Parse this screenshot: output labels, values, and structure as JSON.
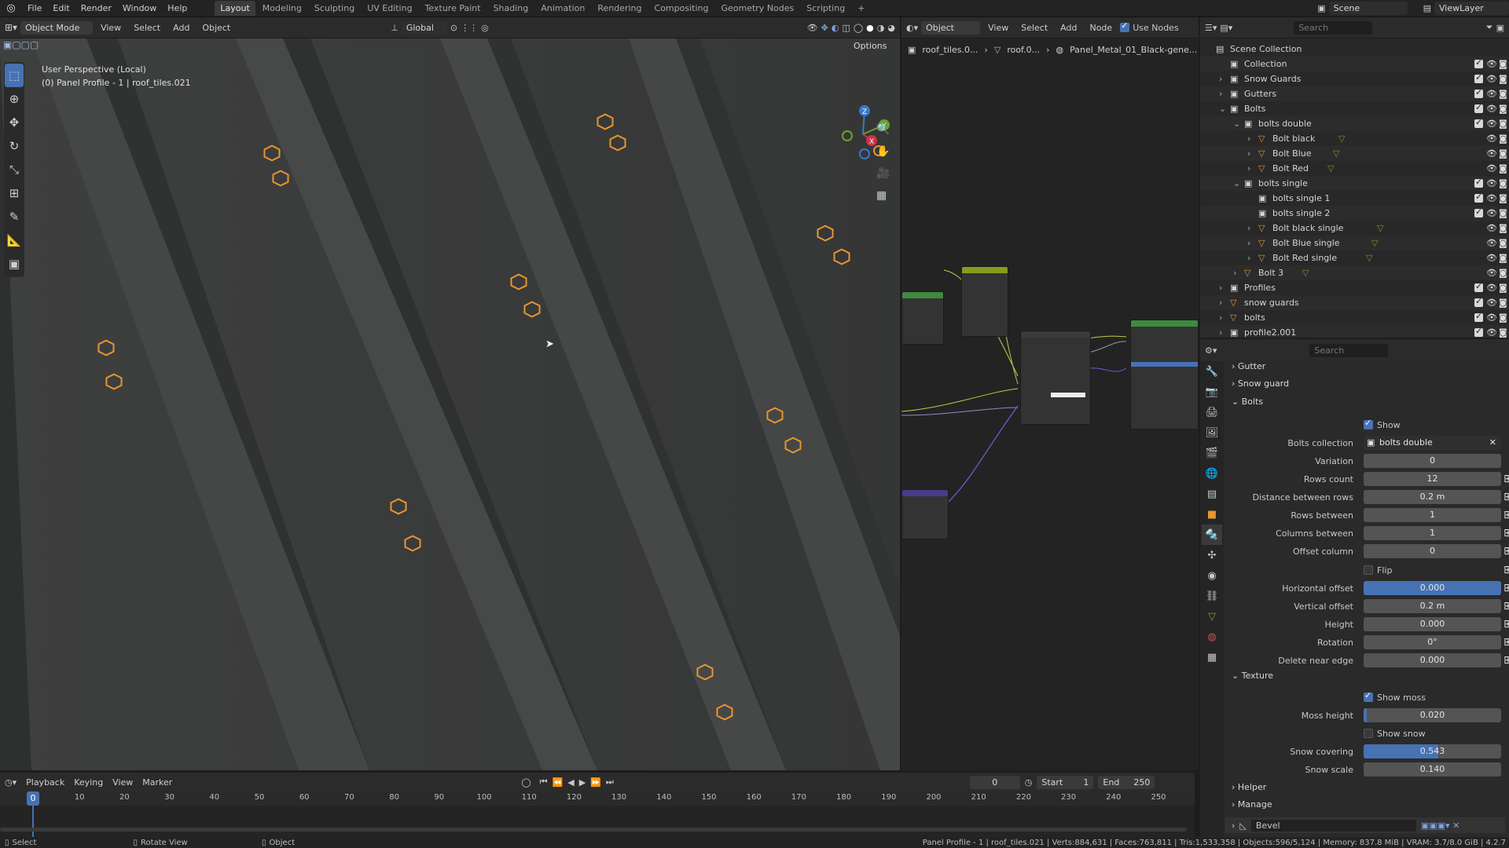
{
  "menus": [
    "File",
    "Edit",
    "Render",
    "Window",
    "Help"
  ],
  "workspaces": [
    "Layout",
    "Modeling",
    "Sculpting",
    "UV Editing",
    "Texture Paint",
    "Shading",
    "Animation",
    "Rendering",
    "Compositing",
    "Geometry Nodes",
    "Scripting"
  ],
  "active_workspace": "Layout",
  "top_right": {
    "scene": "Scene",
    "view_layer": "ViewLayer",
    "search_placeholder": "Search"
  },
  "viewport": {
    "mode": "Object Mode",
    "menu": [
      "View",
      "Select",
      "Add",
      "Object"
    ],
    "orientation": "Global",
    "options": "Options",
    "overlay_line1": "User Perspective (Local)",
    "overlay_line2": "(0) Panel Profile - 1 | roof_tiles.021",
    "gizmo_axes": [
      "Z",
      "Y",
      "X"
    ]
  },
  "node_editor": {
    "object_dropdown": "Object",
    "menu": [
      "View",
      "Select",
      "Add",
      "Node"
    ],
    "use_nodes_label": "Use Nodes",
    "use_nodes": true,
    "breadcrumb": [
      "roof_tiles.0...",
      "roof.0...",
      "Panel_Metal_01_Black-gene..."
    ]
  },
  "outliner": {
    "rows": [
      {
        "label": "Scene Collection",
        "depth": 0,
        "type": "scene",
        "checks": false
      },
      {
        "label": "Collection",
        "depth": 1,
        "type": "collection",
        "checks": true
      },
      {
        "label": "Snow Guards",
        "depth": 1,
        "type": "collection",
        "checks": true,
        "expand": "›"
      },
      {
        "label": "Gutters",
        "depth": 1,
        "type": "collection",
        "checks": true,
        "expand": "›"
      },
      {
        "label": "Bolts",
        "depth": 1,
        "type": "collection",
        "checks": true,
        "expand": "⌄"
      },
      {
        "label": "bolts double",
        "depth": 2,
        "type": "collection",
        "checks": true,
        "expand": "⌄"
      },
      {
        "label": "Bolt black",
        "depth": 3,
        "type": "mesh",
        "checks": false,
        "expand": "›"
      },
      {
        "label": "Bolt Blue",
        "depth": 3,
        "type": "mesh",
        "checks": false,
        "expand": "›"
      },
      {
        "label": "Bolt Red",
        "depth": 3,
        "type": "mesh",
        "checks": false,
        "expand": "›"
      },
      {
        "label": "bolts single",
        "depth": 2,
        "type": "collection",
        "checks": true,
        "expand": "⌄"
      },
      {
        "label": "bolts single 1",
        "depth": 3,
        "type": "collection",
        "checks": true
      },
      {
        "label": "bolts single 2",
        "depth": 3,
        "type": "collection",
        "checks": true
      },
      {
        "label": "Bolt black single",
        "depth": 3,
        "type": "mesh",
        "checks": false,
        "expand": "›"
      },
      {
        "label": "Bolt Blue single",
        "depth": 3,
        "type": "mesh",
        "checks": false,
        "expand": "›"
      },
      {
        "label": "Bolt Red single",
        "depth": 3,
        "type": "mesh",
        "checks": false,
        "expand": "›"
      },
      {
        "label": "Bolt 3",
        "depth": 2,
        "type": "mesh",
        "checks": false,
        "expand": "›"
      },
      {
        "label": "Profiles",
        "depth": 1,
        "type": "collection",
        "checks": true,
        "expand": "›"
      },
      {
        "label": "snow guards",
        "depth": 1,
        "type": "mesh",
        "checks": true,
        "expand": "›"
      },
      {
        "label": "bolts",
        "depth": 1,
        "type": "mesh",
        "checks": true,
        "expand": "›"
      },
      {
        "label": "profile2.001",
        "depth": 1,
        "type": "collection",
        "checks": true,
        "expand": "›"
      }
    ]
  },
  "properties": {
    "search_placeholder": "Search",
    "sections": {
      "gutter": "Gutter",
      "snow_guard": "Snow guard",
      "bolts": "Bolts",
      "texture": "Texture",
      "helper": "Helper",
      "manage": "Manage"
    },
    "show_label": "Show",
    "show": true,
    "bolts_collection_label": "Bolts collection",
    "bolts_collection_value": "bolts double",
    "bolt_fields": [
      {
        "label": "Variation",
        "value": "0"
      },
      {
        "label": "Rows count",
        "value": "12",
        "plus": true
      },
      {
        "label": "Distance between rows",
        "value": "0.2 m",
        "plus": true
      },
      {
        "label": "Rows between",
        "value": "1",
        "plus": true
      },
      {
        "label": "Columns between",
        "value": "1",
        "plus": true
      },
      {
        "label": "Offset column",
        "value": "0",
        "plus": true
      }
    ],
    "flip_label": "Flip",
    "flip": false,
    "bolt_fields2": [
      {
        "label": "Horizontal offset",
        "value": "0.000",
        "plus": true,
        "fill": 1.0
      },
      {
        "label": "Vertical offset",
        "value": "0.2 m",
        "plus": true
      },
      {
        "label": "Height",
        "value": "0.000",
        "plus": true
      },
      {
        "label": "Rotation",
        "value": "0°",
        "plus": true
      },
      {
        "label": "Delete near edge",
        "value": "0.000",
        "plus": true
      }
    ],
    "show_moss_label": "Show moss",
    "show_moss": true,
    "moss_height_label": "Moss height",
    "moss_height": "0.020",
    "moss_height_fill": 0.02,
    "show_snow_label": "Show snow",
    "show_snow": false,
    "snow_covering_label": "Snow covering",
    "snow_covering": "0.543",
    "snow_covering_fill": 0.543,
    "snow_scale_label": "Snow scale",
    "snow_scale": "0.140",
    "modifier_name": "Bevel"
  },
  "timeline": {
    "menu": [
      "Playback",
      "Keying",
      "View",
      "Marker"
    ],
    "current_frame": "0",
    "start_label": "Start",
    "start": "1",
    "end_label": "End",
    "end": "250",
    "ticks": [
      "0",
      "10",
      "20",
      "30",
      "40",
      "50",
      "60",
      "70",
      "80",
      "90",
      "100",
      "110",
      "120",
      "130",
      "140",
      "150",
      "160",
      "170",
      "180",
      "190",
      "200",
      "210",
      "220",
      "230",
      "240",
      "250"
    ]
  },
  "statusbar": {
    "left": [
      "Select",
      "Rotate View",
      "Object"
    ],
    "stats": "Panel Profile - 1 | roof_tiles.021 | Verts:884,631 | Faces:763,811 | Tris:1,533,358 | Objects:596/5,124 | Memory: 837.8 MiB | VRAM: 3.7/8.0 GiB | 4.2.7"
  },
  "colors": {
    "accent": "#4772b3",
    "bolt_outline": "#e8962f",
    "mix_node": "#8a9a1c",
    "principled": "#3f8a3f",
    "normal_map": "#4a3a8c"
  }
}
